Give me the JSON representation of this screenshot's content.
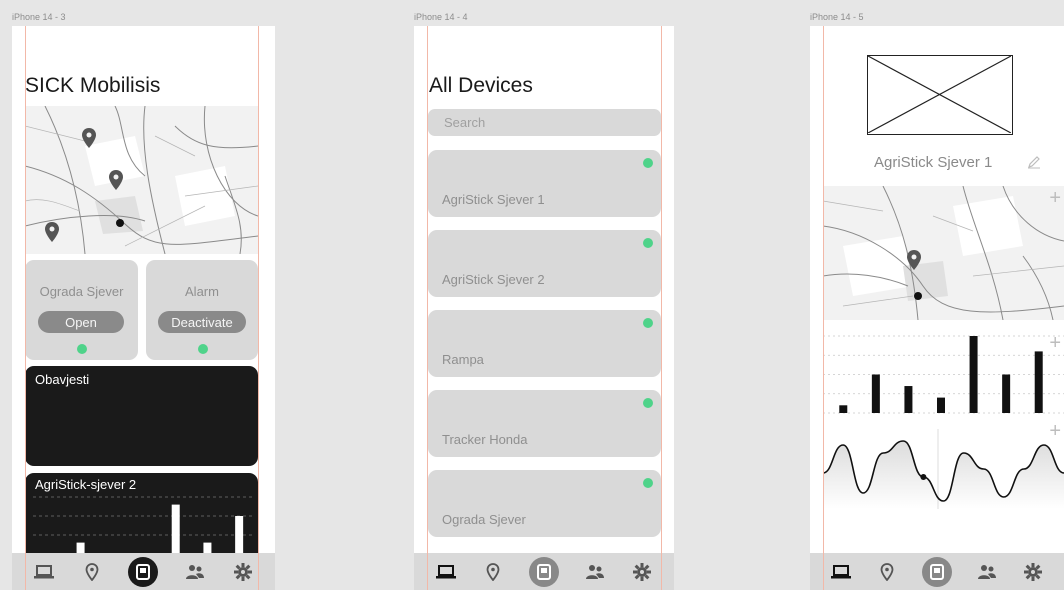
{
  "frames": [
    {
      "label": "iPhone 14 - 3"
    },
    {
      "label": "iPhone 14 - 4"
    },
    {
      "label": "iPhone 14 - 5"
    }
  ],
  "screen_home": {
    "title": "SICK Mobilisis",
    "cards": [
      {
        "title": "Ograda Sjever",
        "button": "Open",
        "status_color": "#4fd38a"
      },
      {
        "title": "Alarm",
        "button": "Deactivate",
        "status_color": "#4fd38a"
      }
    ],
    "notifications_label": "Obavjesti",
    "chart_label": "AgriStick-sjever 2"
  },
  "screen_devices": {
    "title": "All Devices",
    "search_placeholder": "Search",
    "devices": [
      {
        "name": "AgriStick Sjever 1"
      },
      {
        "name": "AgriStick Sjever 2"
      },
      {
        "name": "Rampa"
      },
      {
        "name": "Tracker Honda"
      },
      {
        "name": "Ograda Sjever"
      }
    ]
  },
  "screen_detail": {
    "device_name": "AgriStick Sjever 1",
    "plus_glyph": "+"
  },
  "nav": [
    "laptop-icon",
    "location-pin-icon",
    "device-icon",
    "users-icon",
    "gear-icon"
  ],
  "colors": {
    "status_ok": "#4fd38a",
    "dark": "#1a1a1a",
    "card": "#d9d9d9",
    "guide": "#f2b8a8"
  },
  "chart_data": [
    {
      "type": "bar",
      "values": [
        0.5,
        4,
        2.5,
        1.5,
        9,
        4,
        7.5
      ]
    },
    {
      "type": "bar",
      "values": [
        1,
        5,
        3.5,
        2,
        10,
        5,
        8
      ]
    },
    {
      "type": "line",
      "values": [
        0.55,
        0.2,
        0.8,
        0.3,
        0.15,
        0.6,
        0.9,
        0.3,
        0.5,
        0.85,
        0.5,
        0.2,
        0.55
      ]
    }
  ]
}
